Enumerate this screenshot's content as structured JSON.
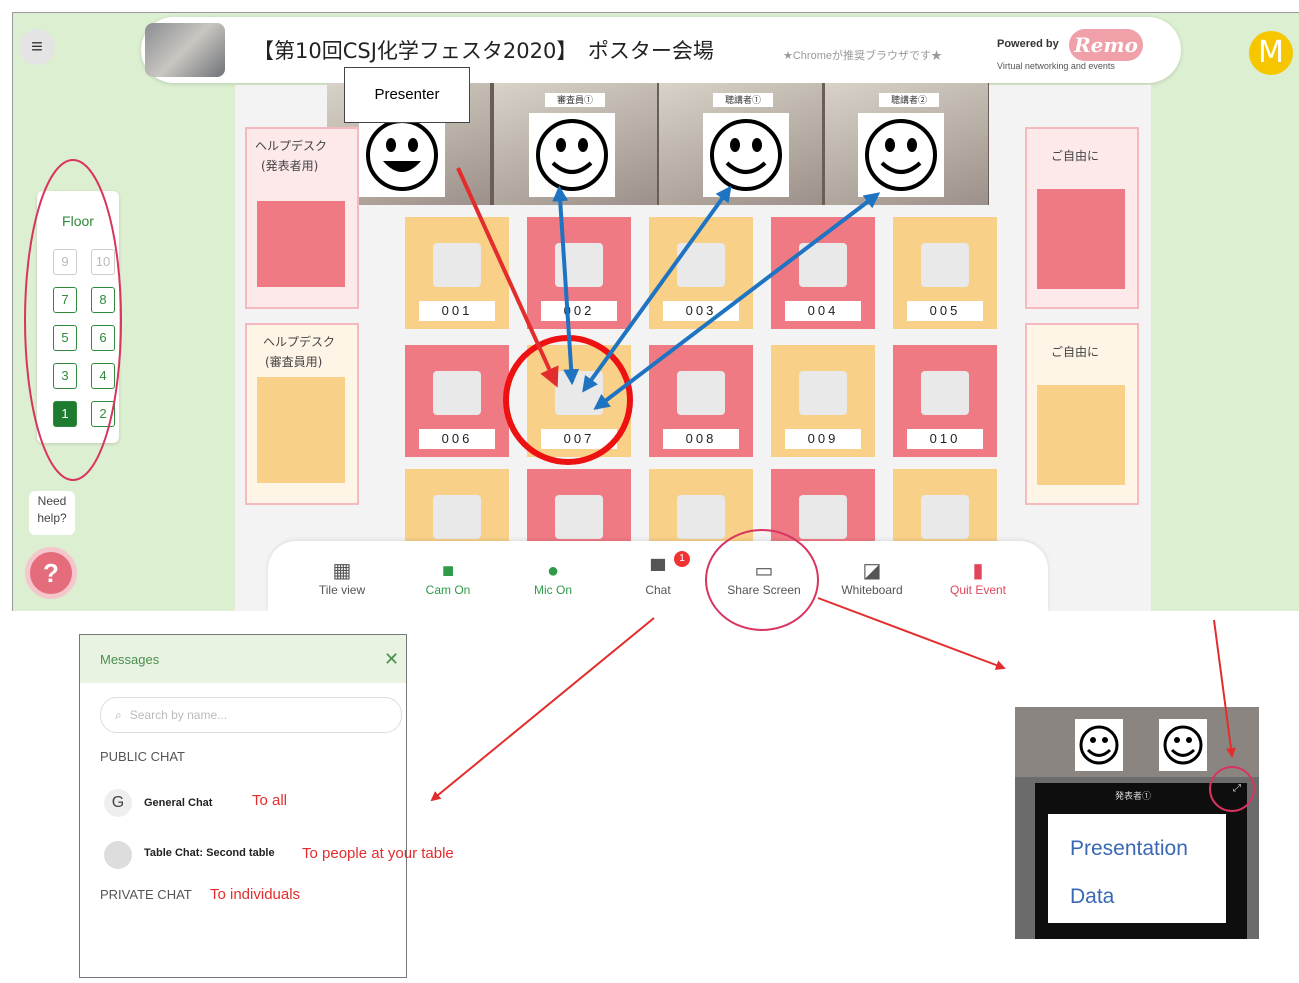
{
  "header": {
    "title": "【第10回CSJ化学フェスタ2020】　ポスター会場",
    "browser_note": "★Chromeが推奨ブラウザです★",
    "powered_by": "Powered by",
    "brand": "Remo",
    "brand_tagline": "Virtual networking and events",
    "user_initial": "M"
  },
  "stage": {
    "presenter_label": "Presenter",
    "video_labels": [
      "審査員①",
      "聴講者①",
      "聴講者②"
    ]
  },
  "floor_panel": {
    "label": "Floor",
    "buttons": [
      "9",
      "10",
      "7",
      "8",
      "5",
      "6",
      "3",
      "4",
      "1",
      "2"
    ],
    "active": "1"
  },
  "help": {
    "label": "Need help?",
    "icon": "?"
  },
  "sides": {
    "left_top": {
      "title": "ヘルプデスク",
      "subtitle": "(発表者用)"
    },
    "left_bottom": {
      "title": "ヘルプデスク",
      "subtitle": "(審査員用)"
    },
    "right_top": {
      "title": "ご自由に"
    },
    "right_bottom": {
      "title": "ご自由に"
    }
  },
  "tables": [
    {
      "label": "001",
      "color": "yel"
    },
    {
      "label": "002",
      "color": "pink"
    },
    {
      "label": "003",
      "color": "yel"
    },
    {
      "label": "004",
      "color": "pink"
    },
    {
      "label": "005",
      "color": "yel"
    },
    {
      "label": "006",
      "color": "pink"
    },
    {
      "label": "007",
      "color": "yel"
    },
    {
      "label": "008",
      "color": "pink"
    },
    {
      "label": "009",
      "color": "yel"
    },
    {
      "label": "010",
      "color": "pink"
    },
    {
      "label": "",
      "color": "yel"
    },
    {
      "label": "",
      "color": "pink"
    },
    {
      "label": "",
      "color": "yel"
    },
    {
      "label": "",
      "color": "pink"
    },
    {
      "label": "",
      "color": "yel"
    }
  ],
  "toolbar": {
    "tile_view": "Tile view",
    "cam_on": "Cam On",
    "mic_on": "Mic On",
    "chat": "Chat",
    "chat_badge": "1",
    "share_screen": "Share Screen",
    "whiteboard": "Whiteboard",
    "quit_event": "Quit Event"
  },
  "messages": {
    "title": "Messages",
    "search_placeholder": "Search by name...",
    "public_chat": "PUBLIC CHAT",
    "general_chat": "General Chat",
    "general_icon": "G",
    "general_note": "To all",
    "table_chat": "Table Chat: Second table",
    "table_note": "To people at your table",
    "private_chat": "PRIVATE CHAT",
    "private_note": "To individuals"
  },
  "share_preview": {
    "presenter_tag": "発表者①",
    "line1": "Presentation",
    "line2": "Data"
  },
  "colors": {
    "accent_green": "#2f8a3b",
    "arrow_red": "#e32d2d",
    "arrow_blue": "#1f74c2"
  }
}
